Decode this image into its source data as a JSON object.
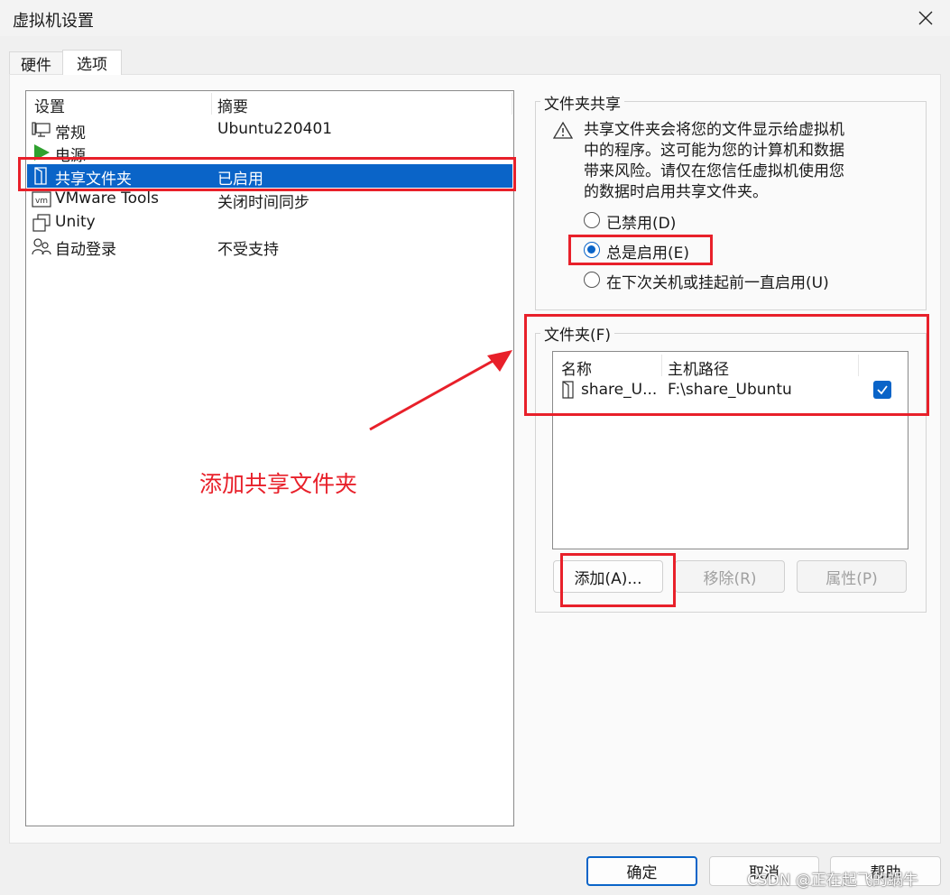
{
  "window": {
    "title": "虚拟机设置"
  },
  "tabs": [
    {
      "label": "硬件",
      "active": false
    },
    {
      "label": "选项",
      "active": true
    }
  ],
  "settings_list": {
    "headers": {
      "setting": "设置",
      "summary": "摘要"
    },
    "items": [
      {
        "name": "常规",
        "summary": "Ubuntu220401",
        "icon": "monitor-icon",
        "selected": false
      },
      {
        "name": "电源",
        "summary": "",
        "icon": "power-play-icon",
        "selected": false
      },
      {
        "name": "共享文件夹",
        "summary": "已启用",
        "icon": "shared-folder-icon",
        "selected": true
      },
      {
        "name": "VMware Tools",
        "summary": "关闭时间同步",
        "icon": "vm-icon",
        "selected": false
      },
      {
        "name": "Unity",
        "summary": "",
        "icon": "unity-windows-icon",
        "selected": false
      },
      {
        "name": "自动登录",
        "summary": "不受支持",
        "icon": "users-icon",
        "selected": false
      }
    ]
  },
  "folder_sharing": {
    "legend": "文件夹共享",
    "warning_lines": [
      "共享文件夹会将您的文件显示给虚拟机",
      "中的程序。这可能为您的计算机和数据",
      "带来风险。请仅在您信任虚拟机使用您",
      "的数据时启用共享文件夹。"
    ],
    "options": [
      {
        "label": "已禁用(D)",
        "checked": false
      },
      {
        "label": "总是启用(E)",
        "checked": true
      },
      {
        "label": "在下次关机或挂起前一直启用(U)",
        "checked": false
      }
    ]
  },
  "folders": {
    "legend": "文件夹(F)",
    "headers": {
      "name": "名称",
      "host_path": "主机路径"
    },
    "rows": [
      {
        "name": "share_U...",
        "host_path": "F:\\share_Ubuntu",
        "enabled": true
      }
    ],
    "buttons": {
      "add": "添加(A)...",
      "remove": "移除(R)",
      "properties": "属性(P)"
    }
  },
  "annotation": {
    "text": "添加共享文件夹",
    "color": "#e8202a"
  },
  "footer": {
    "ok": "确定",
    "cancel": "取消",
    "help": "帮助",
    "watermark": "CSDN @正在起飞的蜗牛"
  },
  "colors": {
    "accent": "#0a64c8",
    "highlight_red": "#e8202a",
    "power_green": "#2fa12f"
  }
}
